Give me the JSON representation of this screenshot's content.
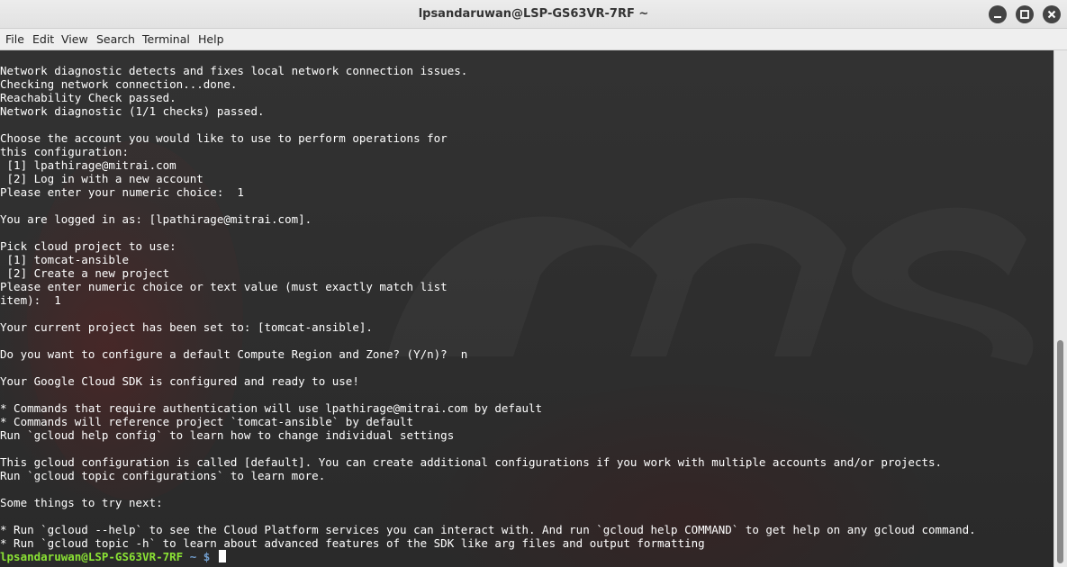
{
  "window": {
    "title": "lpsandaruwan@LSP-GS63VR-7RF ~"
  },
  "menu": {
    "file": "File",
    "edit": "Edit",
    "view": "View",
    "search": "Search",
    "terminal": "Terminal",
    "help": "Help"
  },
  "terminal": {
    "lines": [
      "Network diagnostic detects and fixes local network connection issues.",
      "Checking network connection...done.",
      "Reachability Check passed.",
      "Network diagnostic (1/1 checks) passed.",
      "",
      "Choose the account you would like to use to perform operations for",
      "this configuration:",
      " [1] lpathirage@mitrai.com",
      " [2] Log in with a new account",
      "Please enter your numeric choice:  1",
      "",
      "You are logged in as: [lpathirage@mitrai.com].",
      "",
      "Pick cloud project to use:",
      " [1] tomcat-ansible",
      " [2] Create a new project",
      "Please enter numeric choice or text value (must exactly match list",
      "item):  1",
      "",
      "Your current project has been set to: [tomcat-ansible].",
      "",
      "Do you want to configure a default Compute Region and Zone? (Y/n)?  n",
      "",
      "Your Google Cloud SDK is configured and ready to use!",
      "",
      "* Commands that require authentication will use lpathirage@mitrai.com by default",
      "* Commands will reference project `tomcat-ansible` by default",
      "Run `gcloud help config` to learn how to change individual settings",
      "",
      "This gcloud configuration is called [default]. You can create additional configurations if you work with multiple accounts and/or projects.",
      "Run `gcloud topic configurations` to learn more.",
      "",
      "Some things to try next:",
      "",
      "* Run `gcloud --help` to see the Cloud Platform services you can interact with. And run `gcloud help COMMAND` to get help on any gcloud command.",
      "* Run `gcloud topic -h` to learn about advanced features of the SDK like arg files and output formatting"
    ],
    "prompt": {
      "user_host": "lpsandaruwan@LSP-GS63VR-7RF",
      "dir": "~",
      "symbol": "$"
    }
  },
  "icons": {
    "minimize": "minimize-icon",
    "maximize": "maximize-icon",
    "close": "close-icon"
  },
  "colors": {
    "prompt_user": "#8ae234",
    "prompt_dir": "#729fcf",
    "terminal_text": "#ffffff"
  }
}
